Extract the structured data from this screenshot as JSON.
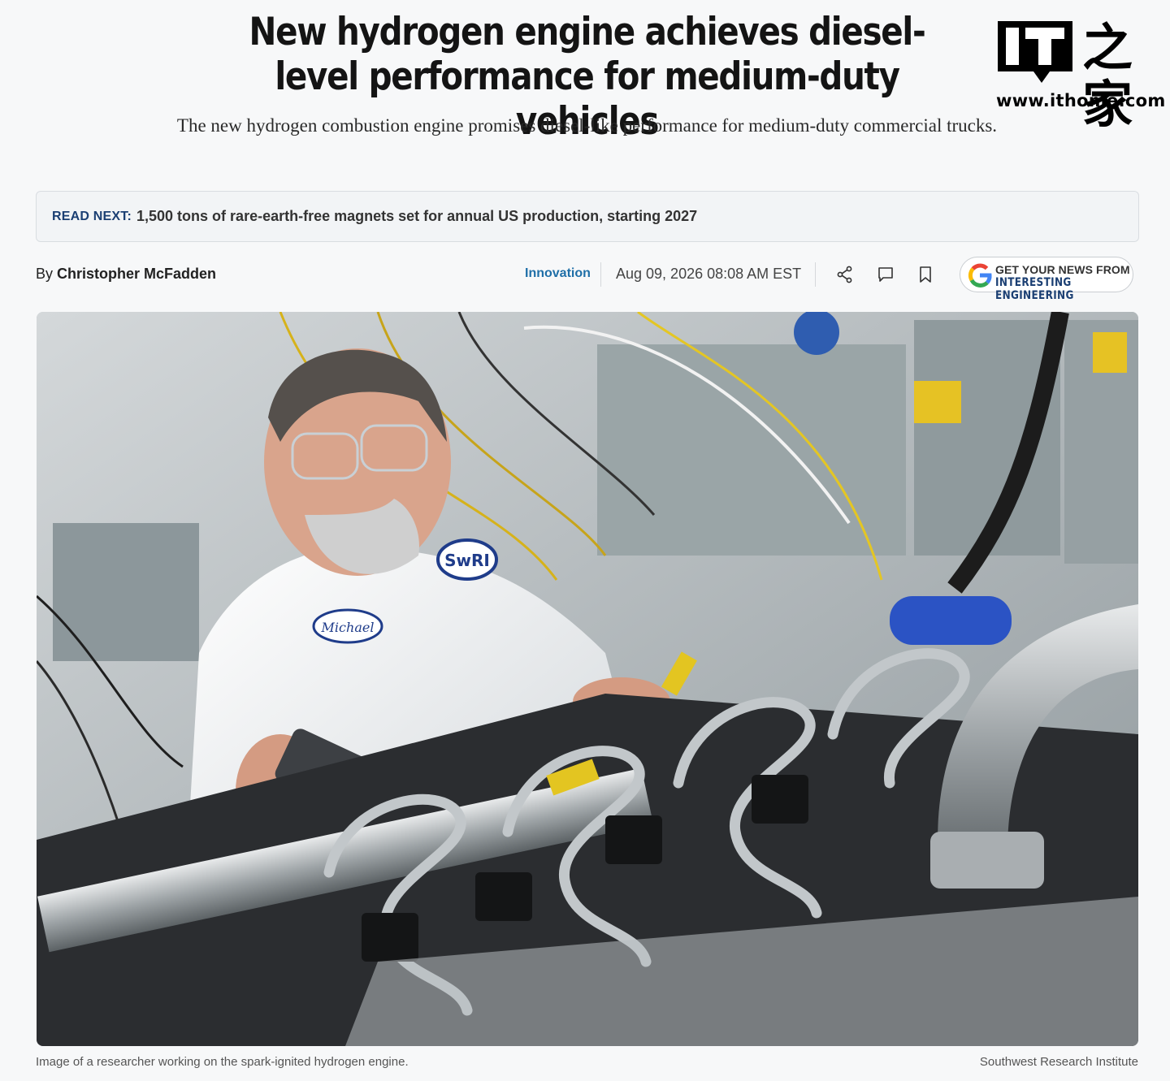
{
  "article": {
    "headline": "New hydrogen engine achieves diesel-level performance for medium-duty vehicles",
    "subhead": "The new hydrogen combustion engine promises diesel-like performance for medium-duty commercial trucks.",
    "read_next_label": "READ NEXT:",
    "read_next_title": "1,500 tons of rare-earth-free magnets set for annual US production, starting 2027",
    "byline_prefix": "By",
    "author": "Christopher McFadden",
    "category": "Innovation",
    "date": "Aug 09, 2026 08:08 AM EST",
    "image_caption": "Image of a researcher working on the spark-ignited hydrogen engine.",
    "image_credit": "Southwest Research Institute"
  },
  "toolbar": {
    "icons": [
      "share-icon",
      "comment-icon",
      "bookmark-icon"
    ]
  },
  "google_news": {
    "line1": "GET YOUR NEWS FROM",
    "line2": "INTERESTING ENGINEERING"
  },
  "watermark": {
    "brand": "IT之家",
    "url": "www.ithome.com"
  },
  "photo_labels": {
    "name_patch": "Michael",
    "logo_patch": "SwRI"
  },
  "colors": {
    "accent": "#1f6fa8",
    "read_next_label": "#1b3f73",
    "background": "#f7f8f9"
  }
}
